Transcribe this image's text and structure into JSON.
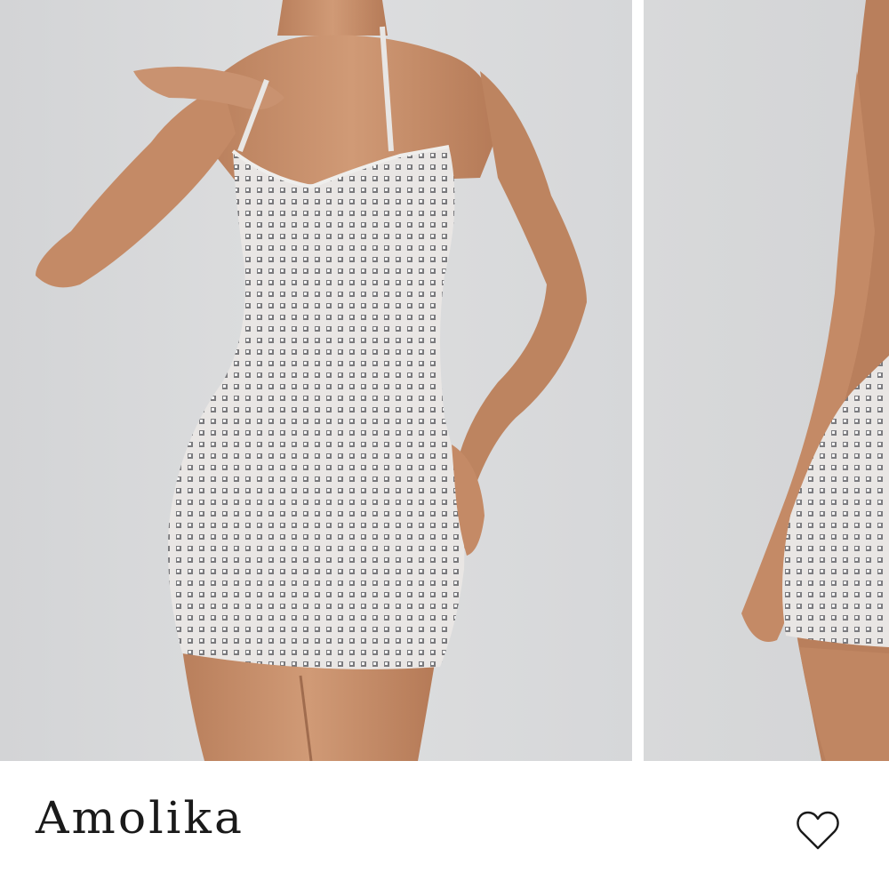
{
  "product": {
    "name": "Amolika"
  },
  "gallery": {
    "images": [
      {
        "icon": "product-photo-front"
      },
      {
        "icon": "product-photo-side"
      }
    ]
  },
  "actions": {
    "wishlist_icon": "heart-outline-icon"
  },
  "colors": {
    "photo_background": "#d7d8d9",
    "skin": "#c8906a",
    "dress": "#e6e3e2",
    "text": "#1a1a1a"
  }
}
